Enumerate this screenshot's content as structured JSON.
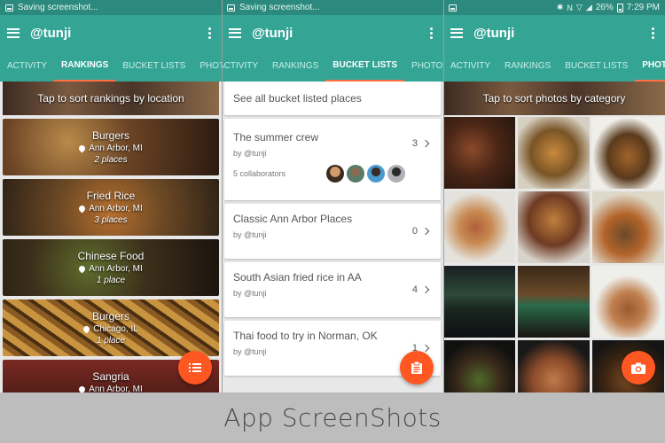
{
  "screens": [
    {
      "status_text": "Saving screenshot...",
      "app_title": "@tunji",
      "tabs": [
        "ACTIVITY",
        "RANKINGS",
        "BUCKET LISTS",
        "PHOTOS"
      ],
      "active_tab": "RANKINGS",
      "banner": "Tap to sort rankings by location",
      "rankings": [
        {
          "name": "Burgers",
          "location": "Ann Arbor, MI",
          "count": "2 places"
        },
        {
          "name": "Fried Rice",
          "location": "Ann Arbor, MI",
          "count": "3 places"
        },
        {
          "name": "Chinese Food",
          "location": "Ann Arbor, MI",
          "count": "1 place"
        },
        {
          "name": "Burgers",
          "location": "Chicago, IL",
          "count": "1 place"
        },
        {
          "name": "Sangria",
          "location": "Ann Arbor, MI",
          "count": ""
        }
      ],
      "fab_icon": "list-icon"
    },
    {
      "status_text": "Saving screenshot...",
      "app_title": "@tunji",
      "tabs": [
        "ACTIVITY",
        "RANKINGS",
        "BUCKET LISTS",
        "PHOTOS"
      ],
      "active_tab": "BUCKET LISTS",
      "see_all": "See all bucket listed places",
      "lists": [
        {
          "title": "The summer crew",
          "by": "by @tunji",
          "count": "3",
          "collaborators": "5 collaborators"
        },
        {
          "title": "Classic Ann Arbor Places",
          "by": "by @tunji",
          "count": "0"
        },
        {
          "title": "South Asian fried rice in AA",
          "by": "by @tunji",
          "count": "4"
        },
        {
          "title": "Thai food to try in Norman, OK",
          "by": "by @tunji",
          "count": "1"
        }
      ],
      "fab_icon": "clipboard-icon"
    },
    {
      "status_text": "",
      "battery": "26%",
      "time": "7:29 PM",
      "app_title": "@tunji",
      "tabs": [
        "ACTIVITY",
        "RANKINGS",
        "BUCKET LISTS",
        "PHOTOS"
      ],
      "active_tab": "PHOTOS",
      "banner": "Tap to sort photos by category",
      "fab_icon": "camera-icon"
    }
  ],
  "caption": "App ScreenShots",
  "colors": {
    "primary": "#34a595",
    "status": "#2b8a7d",
    "accent": "#ff5722",
    "tab_indicator": "#ff7043"
  }
}
